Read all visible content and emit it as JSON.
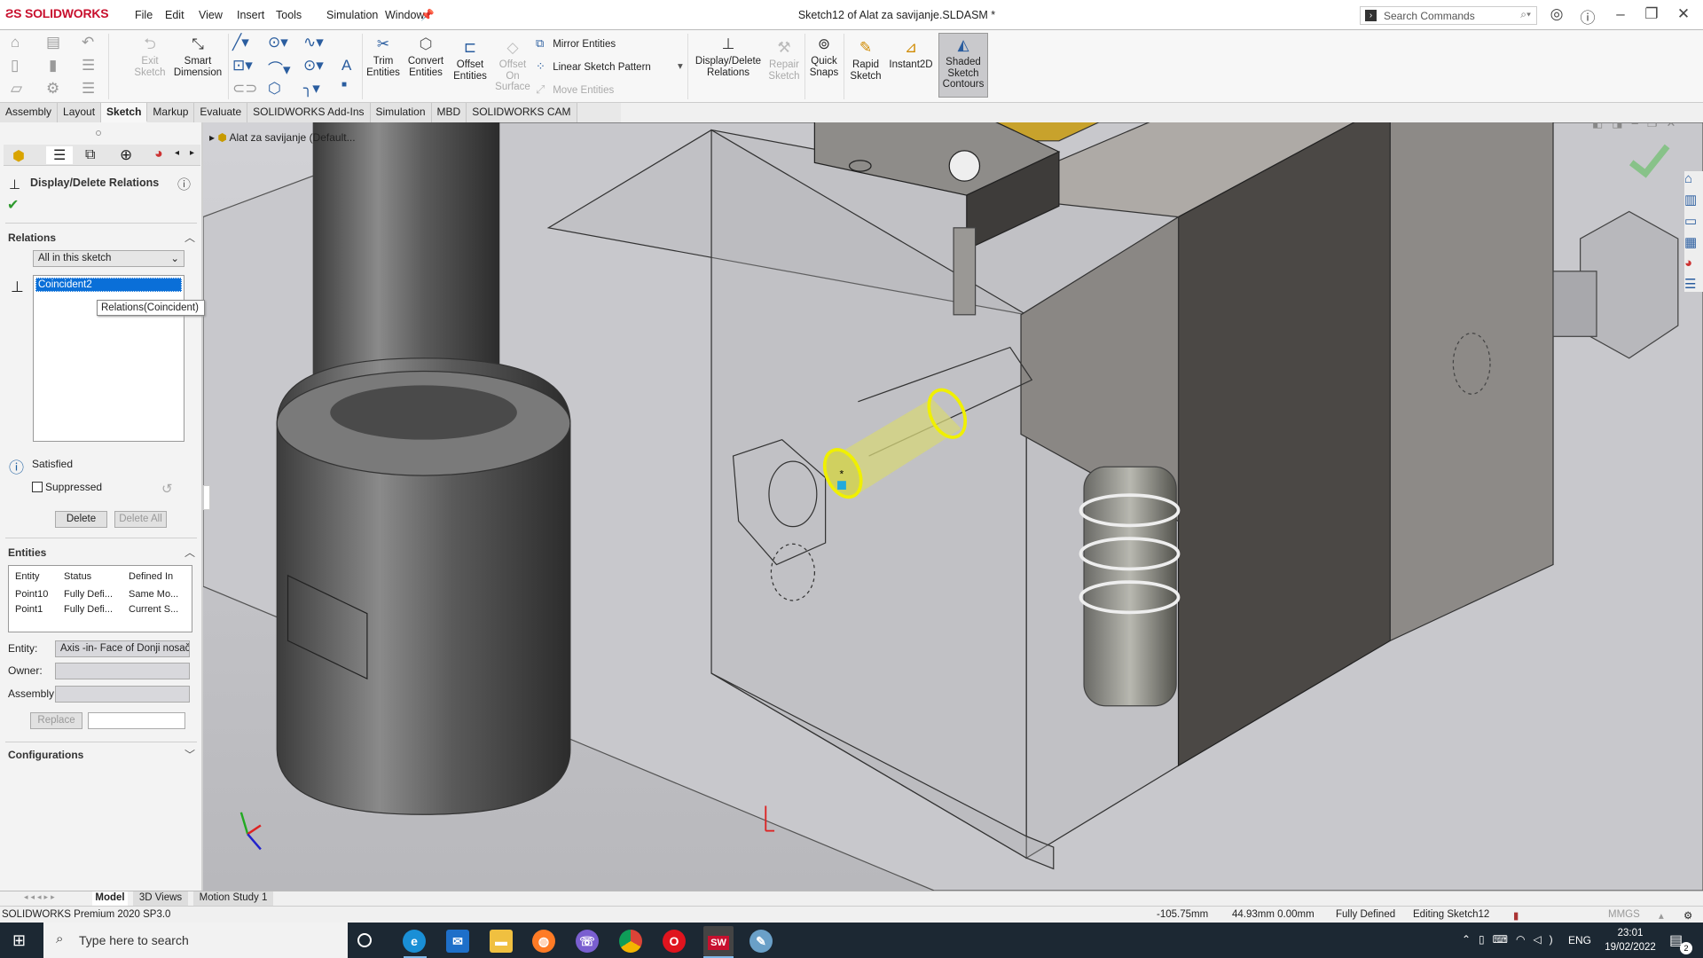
{
  "app": {
    "logo": "SOLIDWORKS",
    "title": "Sketch12 of Alat za savijanje.SLDASM *"
  },
  "menu": [
    "File",
    "Edit",
    "View",
    "Insert",
    "Tools",
    "Simulation",
    "Window"
  ],
  "search": {
    "placeholder": "Search Commands"
  },
  "ribbon": {
    "exit_sketch": "Exit Sketch",
    "smart_dimension": "Smart Dimension",
    "trim": "Trim Entities",
    "convert": "Convert Entities",
    "offset": "Offset Entities",
    "offset_surface": "Offset On Surface",
    "mirror": "Mirror Entities",
    "linear_pattern": "Linear Sketch Pattern",
    "move": "Move Entities",
    "display_delete": "Display/Delete Relations",
    "repair": "Repair Sketch",
    "quick_snaps": "Quick Snaps",
    "rapid": "Rapid Sketch",
    "instant2d": "Instant2D",
    "shaded": "Shaded Sketch Contours"
  },
  "tabs": [
    "Assembly",
    "Layout",
    "Sketch",
    "Markup",
    "Evaluate",
    "SOLIDWORKS Add-Ins",
    "Simulation",
    "MBD",
    "SOLIDWORKS CAM"
  ],
  "active_tab": "Sketch",
  "panel": {
    "title": "Display/Delete Relations",
    "relations_header": "Relations",
    "filter": "All in this sketch",
    "relations": [
      "Coincident2"
    ],
    "tooltip": "Relations(Coincident)",
    "status": "Satisfied",
    "suppressed": "Suppressed",
    "suppressed_checked": false,
    "delete": "Delete",
    "delete_all": "Delete All",
    "entities_header": "Entities",
    "entities_columns": [
      "Entity",
      "Status",
      "Defined In"
    ],
    "entities_rows": [
      [
        "Point10",
        "Fully Defi...",
        "Same Mo..."
      ],
      [
        "Point1",
        "Fully Defi...",
        "Current S..."
      ]
    ],
    "entity_label": "Entity:",
    "entity_value": "Axis -in- Face of Donji nosač",
    "owner_label": "Owner:",
    "assembly_label": "Assembly:",
    "replace": "Replace",
    "configurations_header": "Configurations"
  },
  "viewport": {
    "breadcrumb": "Alat za savijanje  (Default...",
    "accent_sketch": "#f0f000"
  },
  "bottom_tabs": [
    "Model",
    "3D Views",
    "Motion Study 1"
  ],
  "status": {
    "product": "SOLIDWORKS Premium 2020 SP3.0",
    "x": "-105.75mm",
    "yz": "44.93mm 0.00mm",
    "state": "Fully Defined",
    "editing": "Editing Sketch12",
    "units": "MMGS"
  },
  "taskbar": {
    "search": "Type here to search",
    "lang": "ENG",
    "time": "23:01",
    "date": "19/02/2022",
    "notifications": "2"
  }
}
